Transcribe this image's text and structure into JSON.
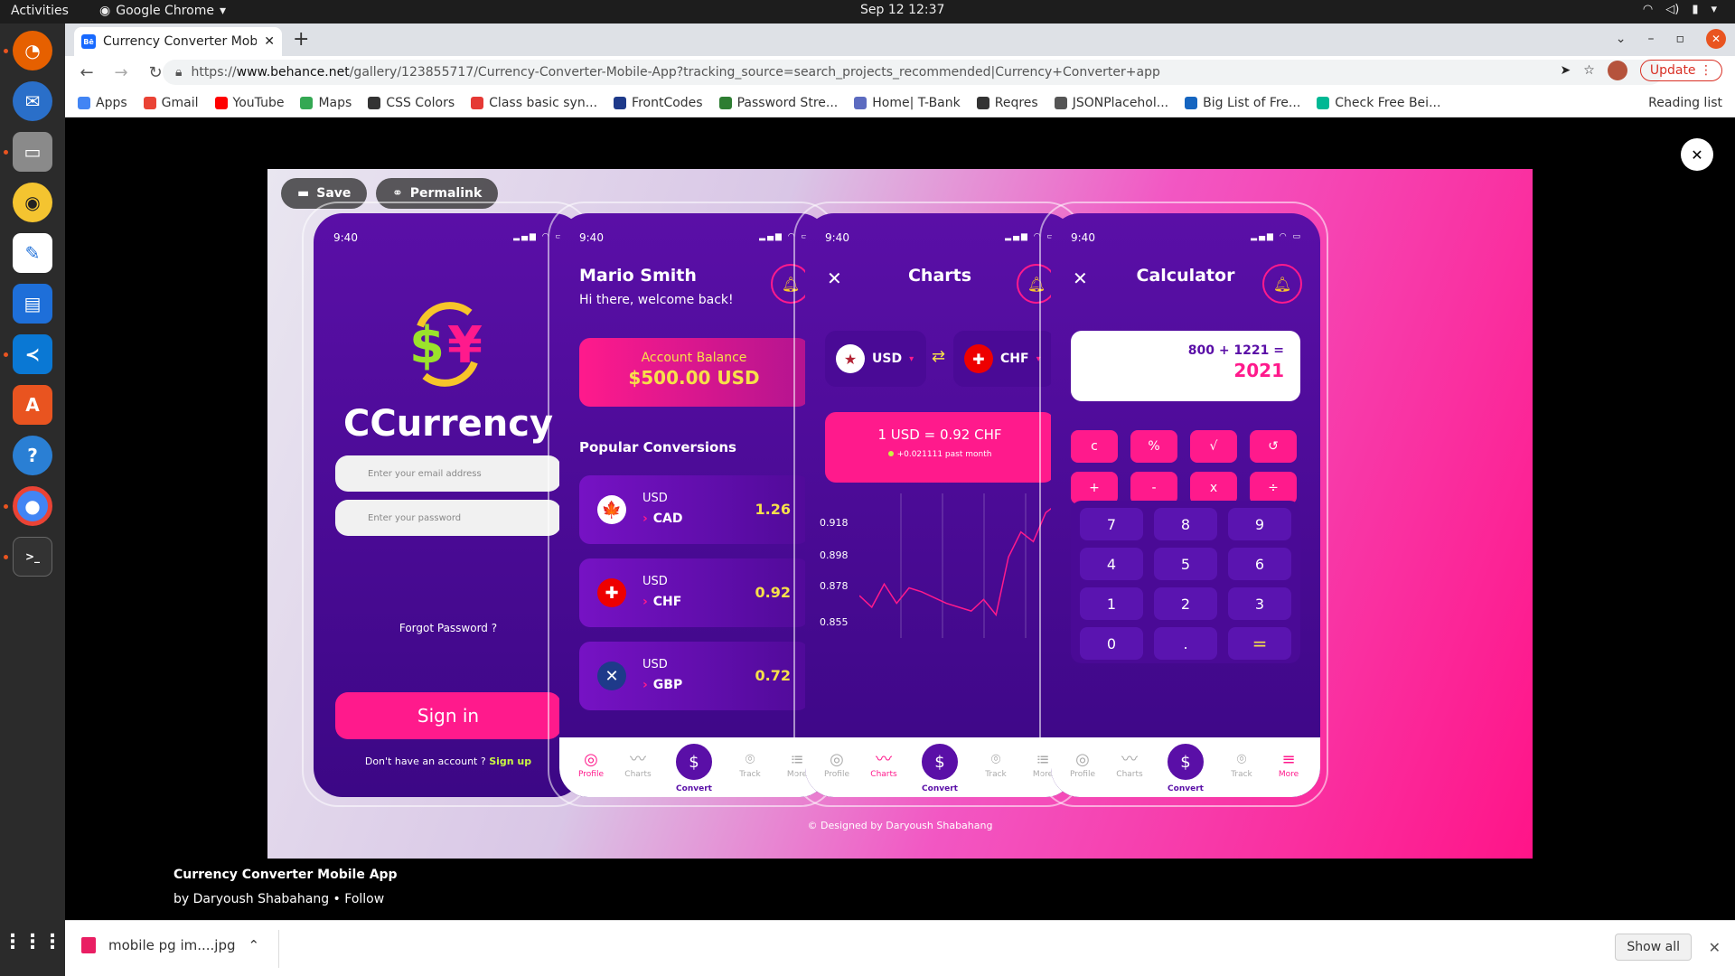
{
  "system": {
    "activities": "Activities",
    "app_name": "Google Chrome",
    "clock": "Sep 12  12:37"
  },
  "browser": {
    "tab_title": "Currency Converter Mobile App",
    "tab_favicon": "Bē",
    "url_scheme": "https://",
    "url_host": "www.behance.net",
    "url_path": "/gallery/123855717/Currency-Converter-Mobile-App?tracking_source=search_projects_recommended|Currency+Converter+app",
    "update_label": "Update"
  },
  "bookmarks": [
    {
      "label": "Apps",
      "color": "#4285f4"
    },
    {
      "label": "Gmail",
      "color": "#ea4335"
    },
    {
      "label": "YouTube",
      "color": "#ff0000"
    },
    {
      "label": "Maps",
      "color": "#34a853"
    },
    {
      "label": "CSS Colors",
      "color": "#333333"
    },
    {
      "label": "Class basic syn...",
      "color": "#e53935"
    },
    {
      "label": "FrontCodes",
      "color": "#1e3a8a"
    },
    {
      "label": "Password Stre...",
      "color": "#2e7d32"
    },
    {
      "label": "Home| T-Bank",
      "color": "#5c6bc0"
    },
    {
      "label": "Reqres",
      "color": "#333333"
    },
    {
      "label": "JSONPlacehol...",
      "color": "#555555"
    },
    {
      "label": "Big List of Fre...",
      "color": "#1565c0"
    },
    {
      "label": "Check Free Bei...",
      "color": "#00b894"
    }
  ],
  "reading_list": "Reading list",
  "project": {
    "save": "Save",
    "permalink": "Permalink",
    "title": "Currency Converter Mobile App",
    "by": "by Daryoush Shabahang",
    "follow": "Follow",
    "credit": "Designed by Daryoush Shabahang"
  },
  "time": "9:40",
  "login": {
    "brand": "CCurrency",
    "email_placeholder": "Enter your email address",
    "password_placeholder": "Enter your password",
    "forgot": "Forgot Password ?",
    "signin": "Sign in",
    "no_account": "Don't have an account ?",
    "signup": "Sign up"
  },
  "home": {
    "name": "Mario Smith",
    "greeting": "Hi there, welcome back!",
    "balance_label": "Account Balance",
    "balance_value": "$500.00 USD",
    "popular": "Popular Conversions",
    "conversions": [
      {
        "from": "USD",
        "to": "CAD",
        "rate": "1.26",
        "flag": "🍁"
      },
      {
        "from": "USD",
        "to": "CHF",
        "rate": "0.92",
        "flag": "✚"
      },
      {
        "from": "USD",
        "to": "GBP",
        "rate": "0.72",
        "flag": "✕"
      }
    ]
  },
  "charts": {
    "title": "Charts",
    "from": "USD",
    "to": "CHF",
    "rate_text": "1 USD = 0.92 CHF",
    "change": "+0.021111 past month",
    "y_ticks": [
      "0.918",
      "0.898",
      "0.878",
      "0.855"
    ]
  },
  "chart_data": {
    "type": "line",
    "title": "",
    "ylabel": "",
    "xlabel": "",
    "ylim": [
      0.85,
      0.925
    ],
    "grid": "vertical",
    "x": [
      0,
      1,
      2,
      3,
      4,
      5,
      6,
      7,
      8,
      9,
      10,
      11,
      12,
      13,
      14,
      15,
      16
    ],
    "values": [
      0.872,
      0.866,
      0.878,
      0.868,
      0.876,
      0.874,
      0.871,
      0.868,
      0.866,
      0.864,
      0.87,
      0.862,
      0.892,
      0.905,
      0.9,
      0.915,
      0.92
    ]
  },
  "calculator": {
    "title": "Calculator",
    "expr": "800 + 1221 =",
    "result": "2021",
    "ops": [
      "c",
      "%",
      "√",
      "↺",
      "+",
      "-",
      "x",
      "÷"
    ],
    "keys": [
      "7",
      "8",
      "9",
      "4",
      "5",
      "6",
      "1",
      "2",
      "3",
      "0",
      ".",
      "="
    ]
  },
  "nav": {
    "profile": "Profile",
    "charts": "Charts",
    "convert": "Convert",
    "track": "Track",
    "more": "More"
  },
  "download": {
    "file": "mobile pg im....jpg",
    "show_all": "Show all"
  }
}
